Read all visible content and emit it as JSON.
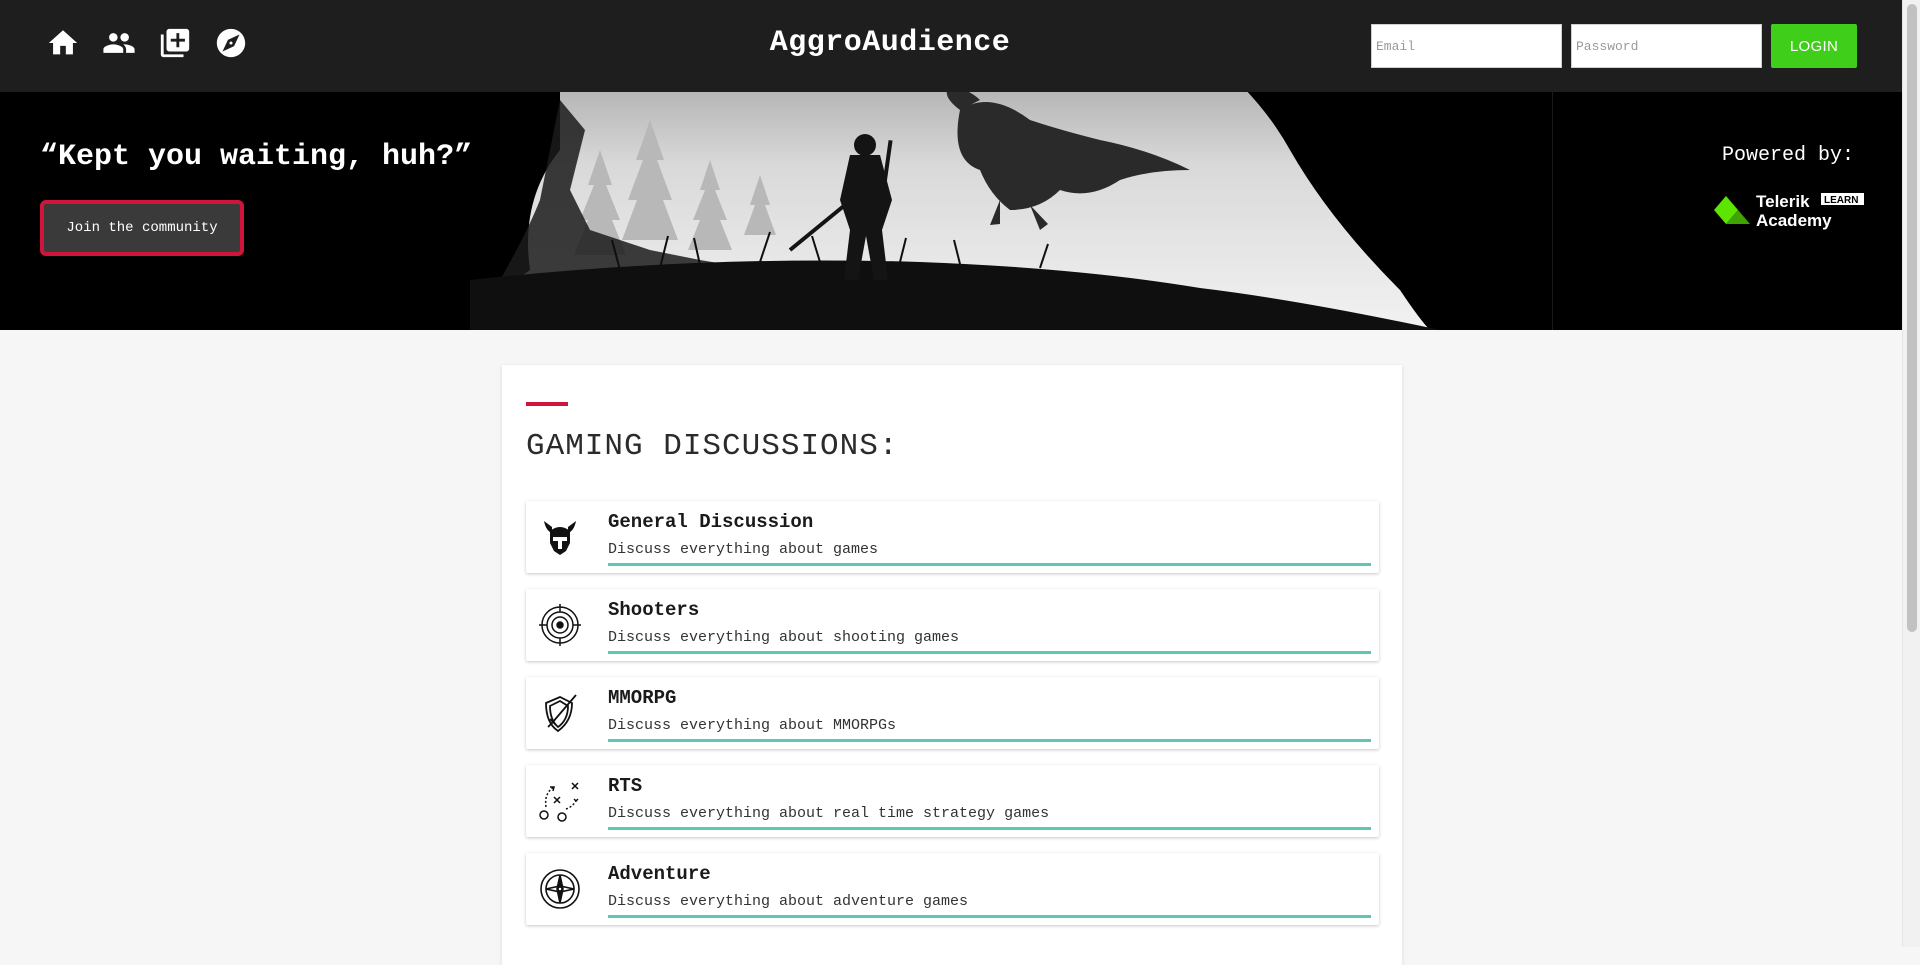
{
  "nav": {
    "brand": "AggroAudience",
    "icons": [
      "home-icon",
      "people-icon",
      "add-post-icon",
      "explore-icon"
    ],
    "email_placeholder": "Email",
    "password_placeholder": "Password",
    "login_label": "LOGIN"
  },
  "hero": {
    "quote": "“Kept you waiting, huh?”",
    "join_label": "Join the community",
    "powered_by": "Powered by:",
    "logo_text_top": "Telerik",
    "logo_text_bottom": "Academy",
    "logo_badge": "LEARN"
  },
  "main": {
    "title": "GAMING DISCUSSIONS:",
    "categories": [
      {
        "title": "General Discussion",
        "description": "Discuss everything about games",
        "icon": "viking-helmet-icon"
      },
      {
        "title": "Shooters",
        "description": "Discuss everything about shooting games",
        "icon": "target-icon"
      },
      {
        "title": "MMORPG",
        "description": "Discuss everything about MMORPGs",
        "icon": "sword-shield-icon"
      },
      {
        "title": "RTS",
        "description": "Discuss everything about real time strategy games",
        "icon": "strategy-plan-icon"
      },
      {
        "title": "Adventure",
        "description": "Discuss everything about adventure games",
        "icon": "compass-icon"
      }
    ]
  },
  "colors": {
    "navbar": "#1e1e1e",
    "login_button": "#3fcf1a",
    "accent_red": "#d1143c",
    "underline_teal": "#5cc8b4",
    "telerik_green": "#5ce500"
  }
}
